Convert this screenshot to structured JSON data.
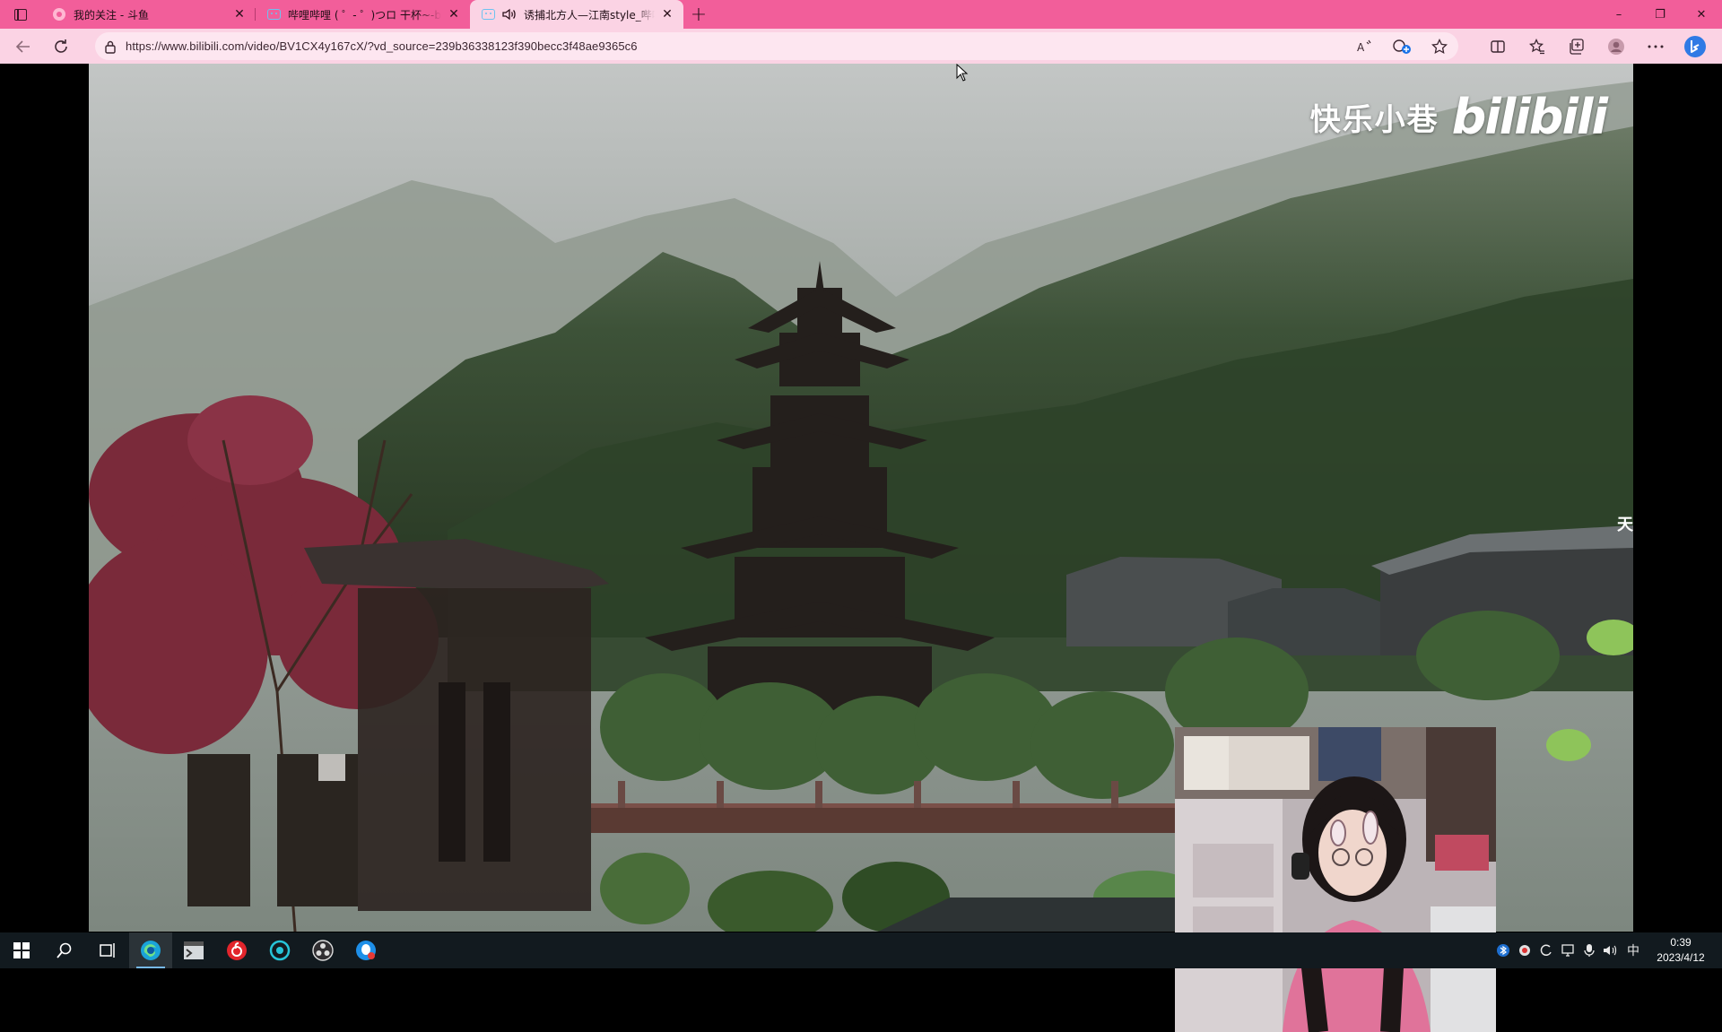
{
  "browser": {
    "tabs": [
      {
        "title": "我的关注 - 斗鱼",
        "favicon": "douyu-icon",
        "state": "inactive"
      },
      {
        "title": "哔哩哔哩 ( ゜- ゜)つロ 干杯~-bilibili",
        "favicon": "bilibili-icon",
        "state": "inactive"
      },
      {
        "title": "诱捕北方人—江南style_哔哩哔哩",
        "favicon": "bilibili-icon",
        "state": "active",
        "audio": true
      }
    ],
    "new_tab_label": "+",
    "window_controls": {
      "minimize": "–",
      "restore": "❐",
      "close": "✕"
    },
    "address": {
      "url": "https://www.bilibili.com/video/BV1CX4y167cX/?vd_source=239b36338123f390becc3f48ae9365c6"
    },
    "accent_color": "#f25e9a",
    "toolbar_color": "#fbd3e4"
  },
  "video": {
    "watermark_text": "快乐小巷",
    "watermark_logo": "bilibili",
    "sign_text": "天"
  },
  "taskbar": {
    "apps": [
      "windows-start-icon",
      "search-icon",
      "task-view-icon",
      "edge-icon",
      "terminal-icon",
      "netease-music-icon",
      "app-circle-icon",
      "obs-icon",
      "qq-icon"
    ],
    "tray": {
      "ime": "中",
      "time": "0:39",
      "date": "2023/4/12"
    }
  }
}
